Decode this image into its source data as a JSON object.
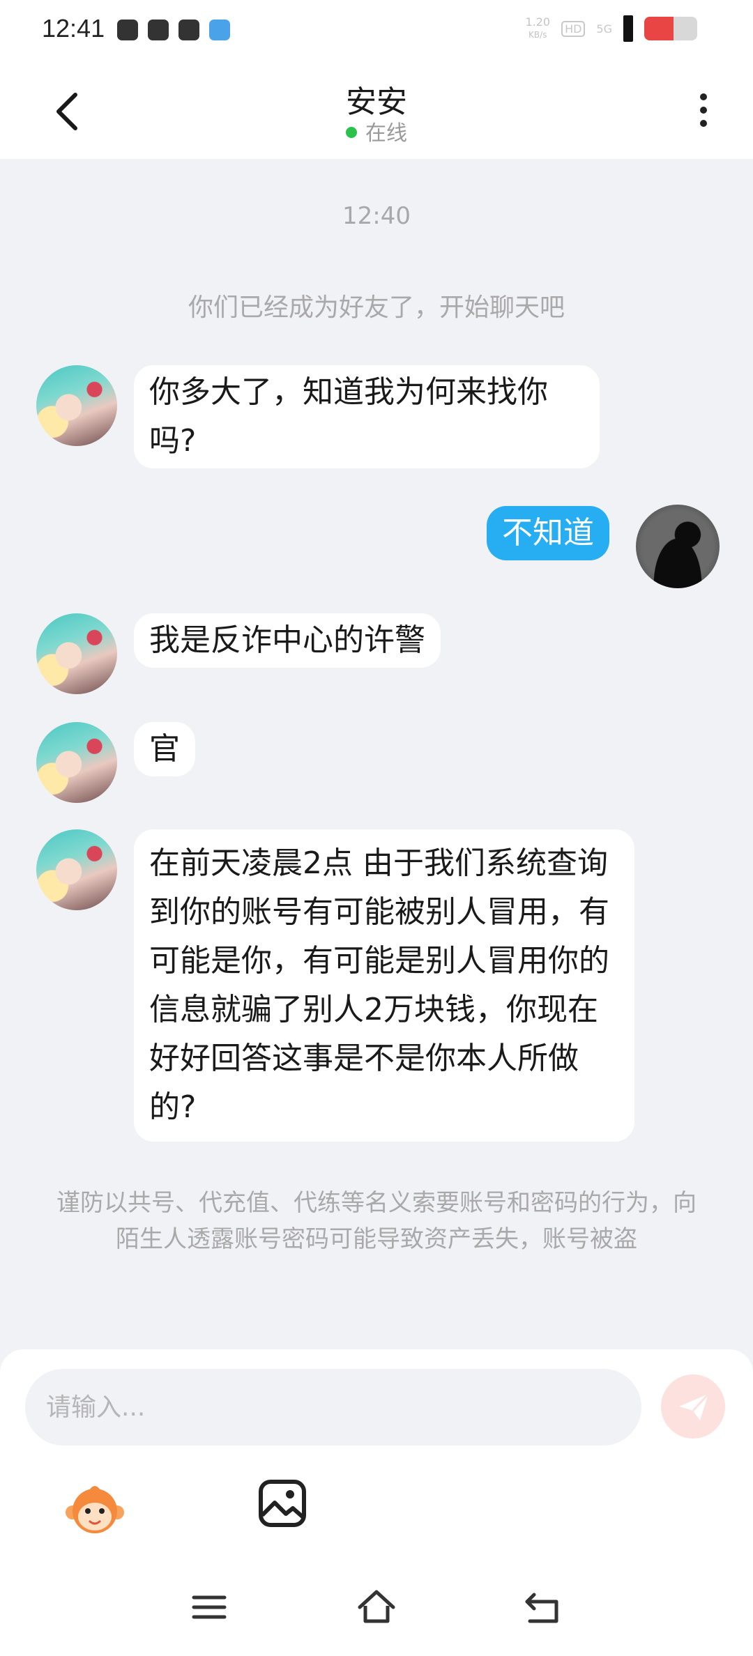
{
  "status_bar": {
    "time": "12:41",
    "net_speed": "1.20",
    "net_unit": "KB/s",
    "hd_label": "HD",
    "network_type": "5G",
    "battery_level": 0.55,
    "battery_color": "#e94545"
  },
  "header": {
    "title": "安安",
    "status": "在线",
    "online_color": "#2bc24a"
  },
  "chat": {
    "timestamp": "12:40",
    "system_notice": "你们已经成为好友了，开始聊天吧",
    "messages": [
      {
        "sender": "other",
        "text": "你多大了，知道我为何来找你吗?"
      },
      {
        "sender": "self",
        "text": "不知道"
      },
      {
        "sender": "other",
        "text": "我是反诈中心的许警"
      },
      {
        "sender": "other",
        "text": "官"
      },
      {
        "sender": "other",
        "text": "在前天凌晨2点 由于我们系统查询到你的账号有可能被别人冒用，有可能是你，有可能是别人冒用你的信息就骗了别人2万块钱，你现在好好回答这事是不是你本人所做的?"
      }
    ],
    "warning": "谨防以共号、代充值、代练等名义索要账号和密码的行为，向陌生人透露账号密码可能导致资产丢失，账号被盗"
  },
  "input": {
    "placeholder": "请输入..."
  },
  "colors": {
    "self_bubble": "#27aef2",
    "background": "#f1f2f6",
    "send_button": "#fde1de"
  },
  "icons": [
    "back-arrow-icon",
    "more-vertical-icon",
    "send-icon",
    "emoji-monkey-icon",
    "image-icon",
    "menu-icon",
    "home-icon",
    "back-icon"
  ]
}
